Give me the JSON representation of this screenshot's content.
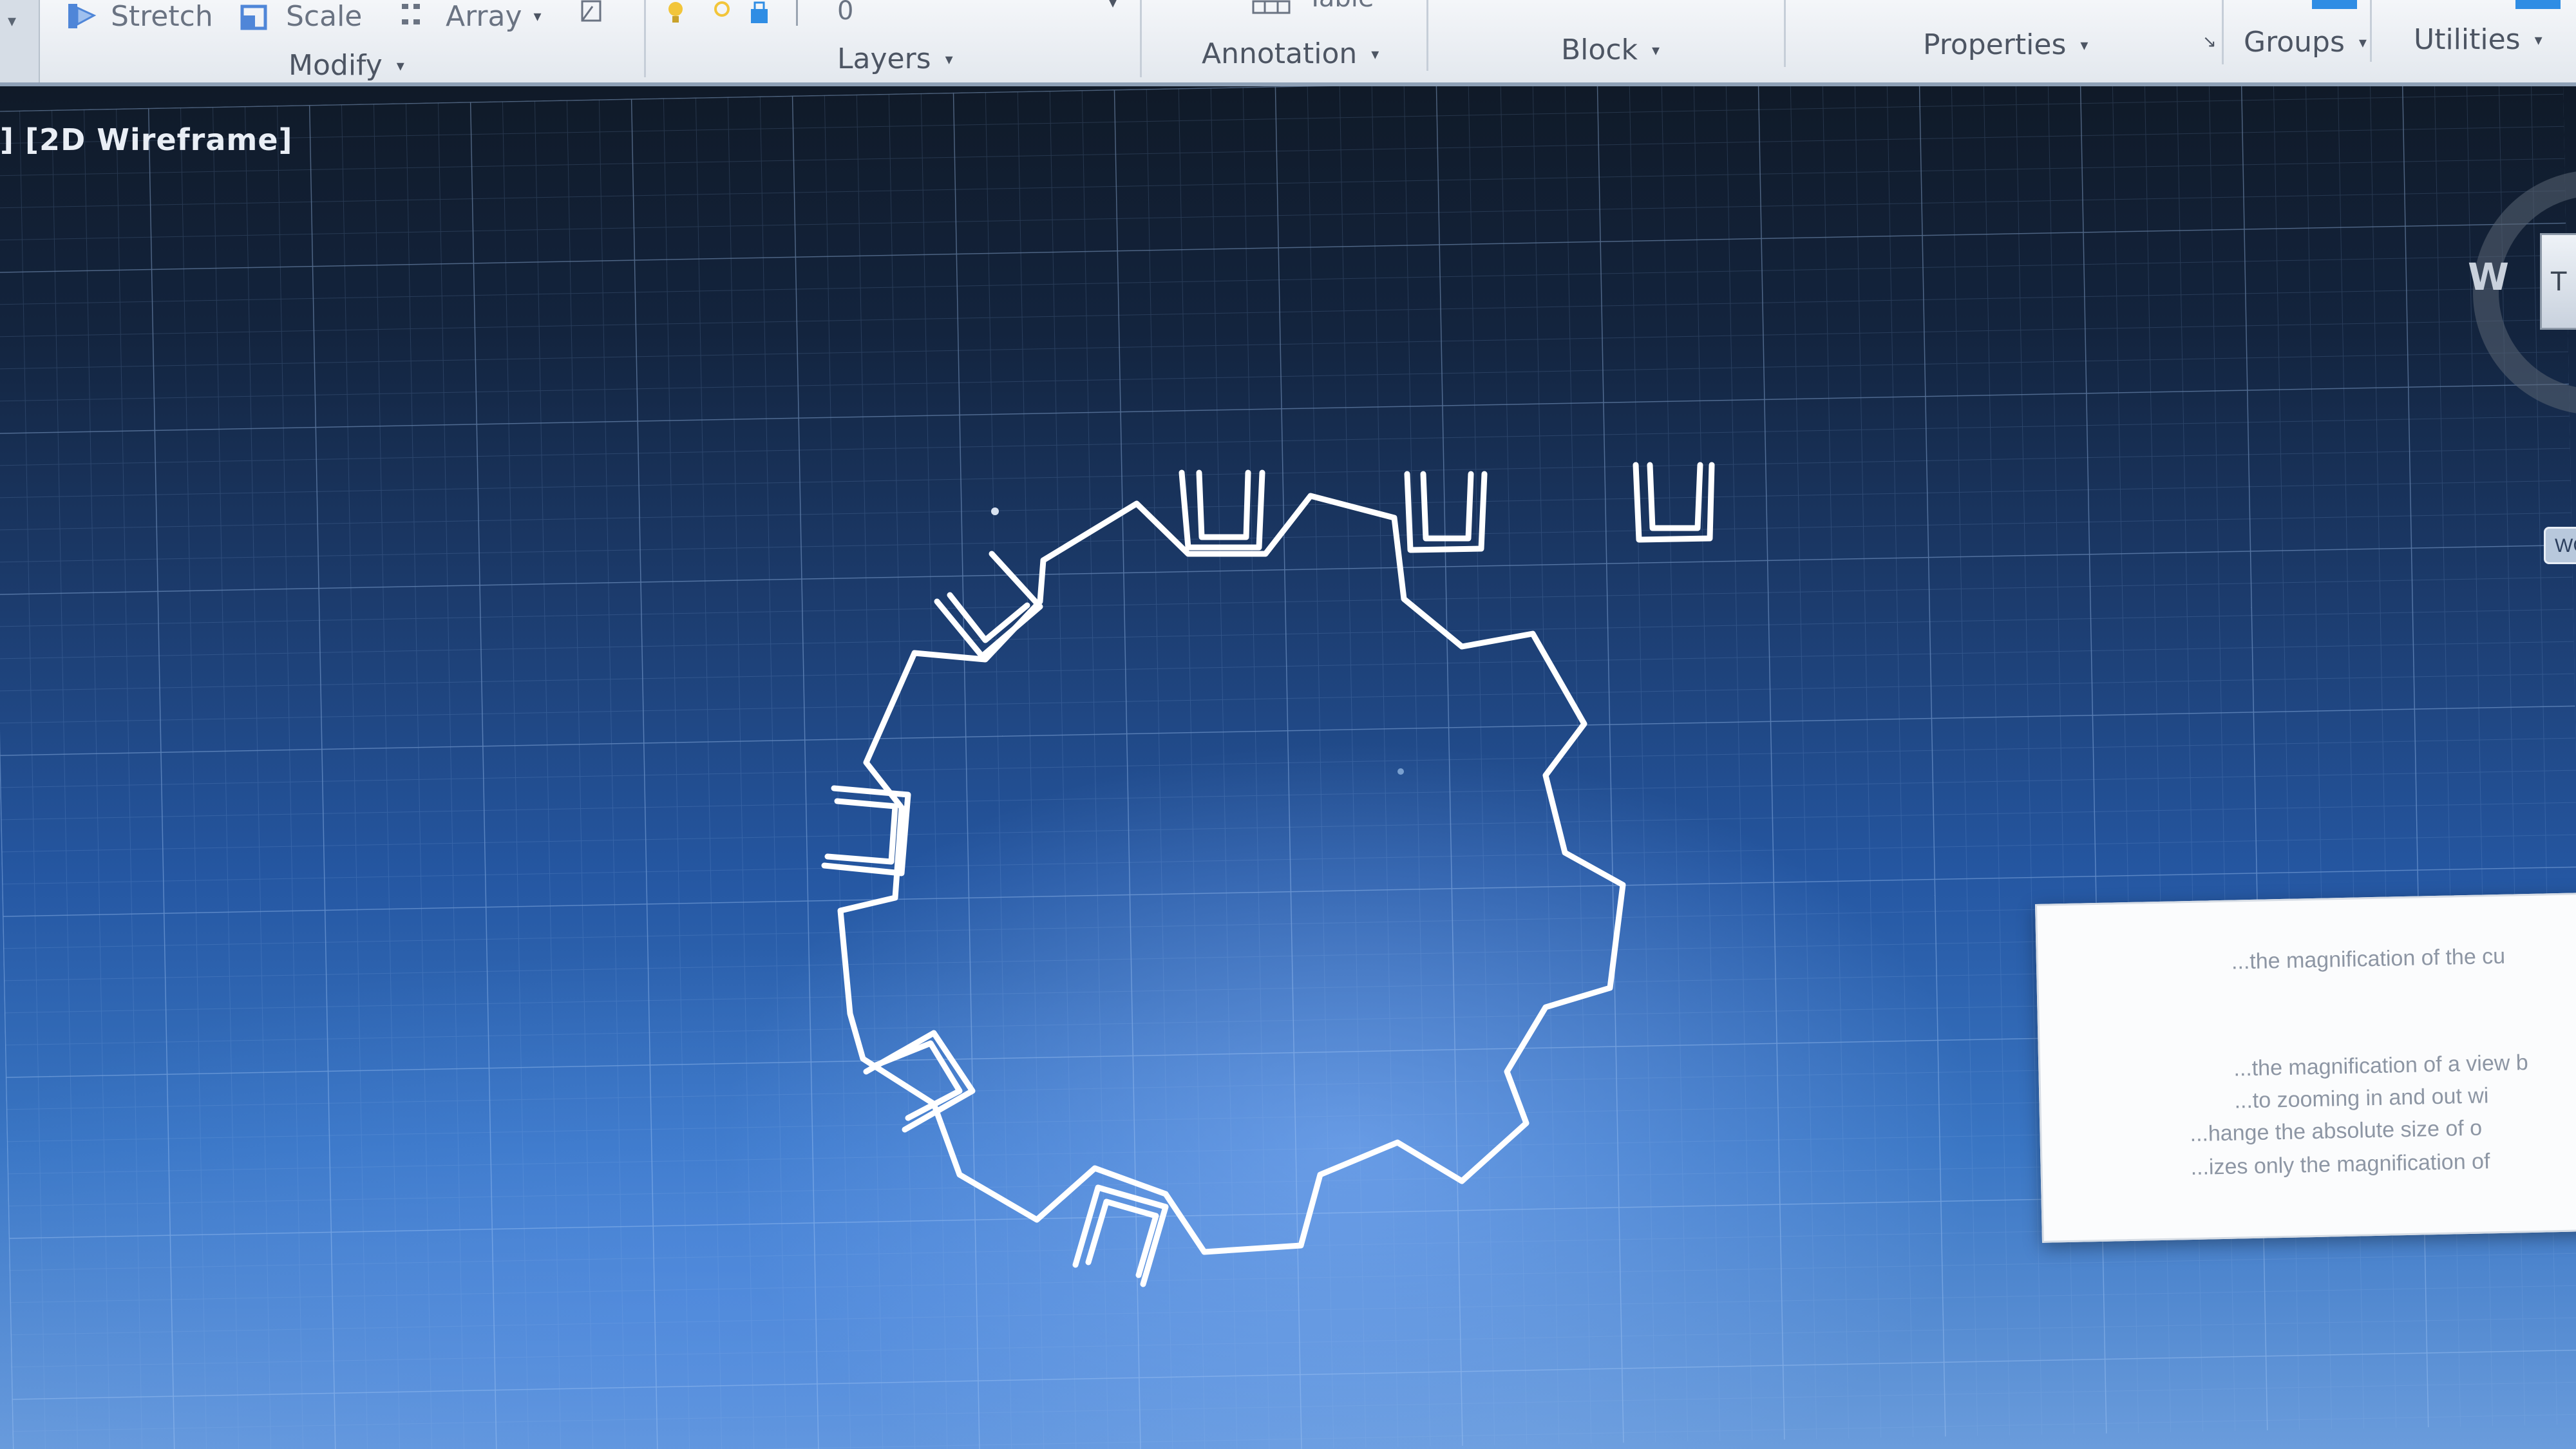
{
  "ribbon": {
    "tools": [
      {
        "name": "stretch",
        "label": "Stretch",
        "icon": "stretch-icon"
      },
      {
        "name": "scale",
        "label": "Scale",
        "icon": "scale-icon"
      },
      {
        "name": "array",
        "label": "Array",
        "icon": "array-icon"
      }
    ],
    "layer_value": "0",
    "panels": {
      "modify": "Modify",
      "layers": "Layers",
      "annotation": "Annotation",
      "block": "Block",
      "properties": "Properties",
      "groups": "Groups",
      "utilities": "Utilities"
    },
    "annotation_top": "Table"
  },
  "viewport": {
    "label": "] [2D Wireframe]",
    "background_colors": [
      "#101a28",
      "#2557a2",
      "#6a9cdc"
    ],
    "drawing_color": "#ffffff"
  },
  "viewcube": {
    "compass_west": "W",
    "face_label": "T",
    "wcs_label": "WC"
  },
  "tooltip": {
    "lines": [
      "...the magnification of the cu",
      "...the magnification of a view b",
      "...to zooming in and out wi",
      "...hange the absolute size of o",
      "...izes only the magnification of"
    ]
  },
  "colors": {
    "ribbon_bg": "#eef1f5",
    "ribbon_text": "#4d5563",
    "accent_blue": "#2f8de4",
    "icon_yellow": "#f2c53a"
  }
}
